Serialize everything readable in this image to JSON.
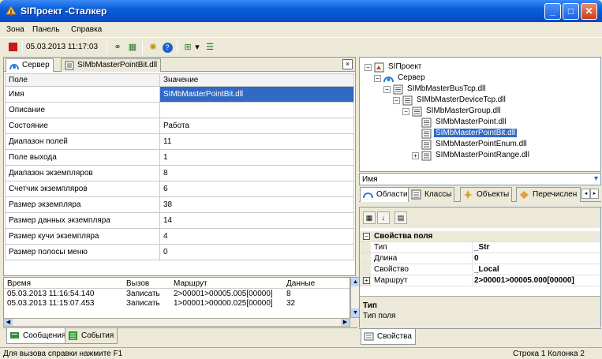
{
  "window": {
    "title": "SIProject -Stalker",
    "title_display": "SIПроект -Сталкер",
    "controls": {
      "minimize": "_",
      "maximize": "□",
      "close": "✕"
    }
  },
  "menu": {
    "items": [
      "Зона",
      "Панель",
      "Справка"
    ]
  },
  "toolbar": {
    "datetime": "05.03.2013 11:17:03"
  },
  "left_panel": {
    "tabs": [
      "Сервер",
      "SIMbMasterPointBit.dll"
    ],
    "close": "×",
    "header": {
      "col1": "Поле",
      "col2": "Значение"
    },
    "rows": [
      {
        "field": "Имя",
        "value": "SIMbMasterPointBit.dll"
      },
      {
        "field": "Описание",
        "value": ""
      },
      {
        "field": "Состояние",
        "value": "Работа"
      },
      {
        "field": "Диапазон полей",
        "value": "11"
      },
      {
        "field": "Поле выхода",
        "value": "1"
      },
      {
        "field": "Диапазон экземпляров",
        "value": "8"
      },
      {
        "field": "Счетчик экземпляров",
        "value": "6"
      },
      {
        "field": "Размер экземпляра",
        "value": "38"
      },
      {
        "field": "Размер данных экземпляра",
        "value": "14"
      },
      {
        "field": "Размер кучи экземпляра",
        "value": "4"
      },
      {
        "field": "Размер полосы меню",
        "value": "0"
      }
    ]
  },
  "log": {
    "headers": [
      "Время",
      "Вызов",
      "Маршрут",
      "Данные"
    ],
    "rows": [
      [
        "05.03.2013 11:16:54.140",
        "Записать",
        "2>00001>00005.005[00000]",
        "8"
      ],
      [
        "05.03.2013 11:15:07.453",
        "Записать",
        "1>00001>00000.025[00000]",
        "32"
      ]
    ],
    "tabs": [
      "Сообщения",
      "События"
    ]
  },
  "tree": {
    "nodes": [
      {
        "label": "SIПроект",
        "level": 0,
        "expander": "−"
      },
      {
        "label": "Сервер",
        "level": 1,
        "expander": "−"
      },
      {
        "label": "SIMbMasterBusTcp.dll",
        "level": 2,
        "expander": "−"
      },
      {
        "label": "SIMbMasterDeviceTcp.dll",
        "level": 3,
        "expander": "−"
      },
      {
        "label": "SIMbMasterGroup.dll",
        "level": 4,
        "expander": "−"
      },
      {
        "label": "SIMbMasterPoint.dll",
        "level": 5,
        "expander": ""
      },
      {
        "label": "SIMbMasterPointBit.dll",
        "level": 5,
        "expander": "",
        "selected": true
      },
      {
        "label": "SIMbMasterPointEnum.dll",
        "level": 5,
        "expander": ""
      },
      {
        "label": "SIMbMasterPointRange.dll",
        "level": 5,
        "expander": "+"
      }
    ]
  },
  "name_bar": {
    "label": "Имя",
    "arrow": "▾"
  },
  "right_tabs": [
    "Области",
    "Классы",
    "Объекты",
    "Перечислен"
  ],
  "right_nav": {
    "left": "◂",
    "right": "▸"
  },
  "property_grid": {
    "category": "Свойства поля",
    "collapse": "−",
    "expand": "+",
    "rows": [
      {
        "key": "Тип",
        "value": "_Str"
      },
      {
        "key": "Длина",
        "value": "0"
      },
      {
        "key": "Свойство",
        "value": "_Local"
      },
      {
        "key": "Маршрут",
        "value": "2>00001>00005.000[00000]"
      }
    ],
    "desc_title": "Тип",
    "desc_text": "Тип поля",
    "tab": "Свойства"
  },
  "status": {
    "help": "Для вызова справки нажмите F1",
    "position": "Строка 1  Колонка 2"
  },
  "colors": {
    "title": "#0a5fd8",
    "selection": "#316ac5",
    "face": "#ece9d8"
  }
}
